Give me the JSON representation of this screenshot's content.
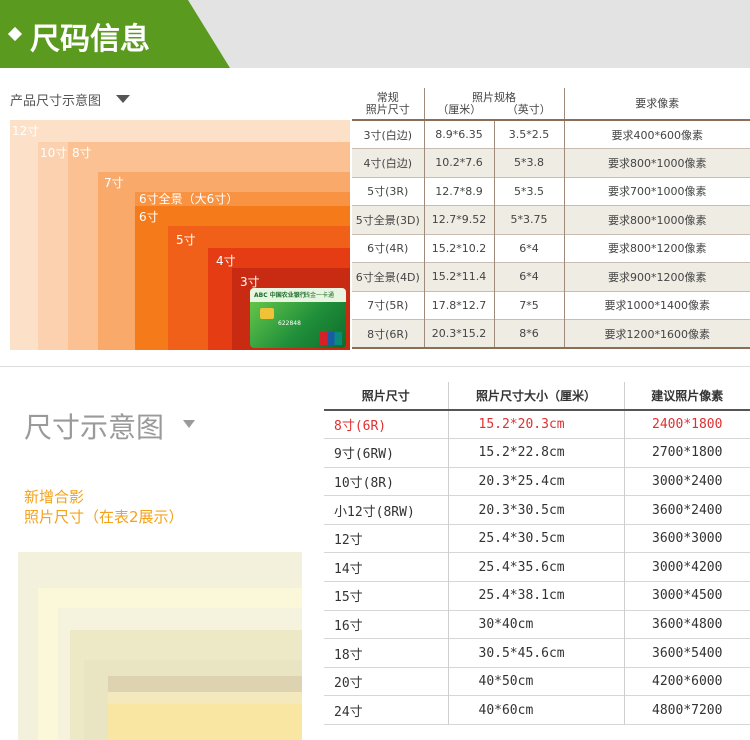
{
  "header": {
    "title": "尺码信息",
    "accent_color": "#5a9a1e"
  },
  "diagram1": {
    "label": "产品尺寸示意图",
    "sizes": [
      {
        "label": "12寸",
        "color": "#fde0c8"
      },
      {
        "label": "10寸",
        "color": "#fcd1b0"
      },
      {
        "label": "8寸",
        "color": "#fbc193"
      },
      {
        "label": "7寸",
        "color": "#f9aa6b"
      },
      {
        "label": "6寸全景（大6寸）",
        "color": "#f79343"
      },
      {
        "label": "6寸",
        "color": "#f47a1a"
      },
      {
        "label": "5寸",
        "color": "#f06018"
      },
      {
        "label": "4寸",
        "color": "#e63c14"
      },
      {
        "label": "3寸",
        "color": "#c82a12"
      }
    ],
    "card": {
      "bank": "ABC 中国农业银行",
      "tag": "钱金一卡通",
      "number": "622848"
    }
  },
  "table1": {
    "headers": {
      "col1_line1": "常规",
      "col1_line2": "照片尺寸",
      "group": "照片规格",
      "col2": "（厘米）",
      "col3": "（英寸）",
      "col4": "要求像素"
    },
    "rows": [
      {
        "name": "3寸(白边)",
        "cm": "8.9*6.35",
        "inch": "3.5*2.5",
        "px": "要求400*600像素"
      },
      {
        "name": "4寸(白边)",
        "cm": "10.2*7.6",
        "inch": "5*3.8",
        "px": "要求800*1000像素"
      },
      {
        "name": "5寸(3R)",
        "cm": "12.7*8.9",
        "inch": "5*3.5",
        "px": "要求700*1000像素"
      },
      {
        "name": "5寸全景(3D)",
        "cm": "12.7*9.52",
        "inch": "5*3.75",
        "px": "要求800*1000像素"
      },
      {
        "name": "6寸(4R)",
        "cm": "15.2*10.2",
        "inch": "6*4",
        "px": "要求800*1200像素"
      },
      {
        "name": "6寸全景(4D)",
        "cm": "15.2*11.4",
        "inch": "6*4",
        "px": "要求900*1200像素"
      },
      {
        "name": "7寸(5R)",
        "cm": "17.8*12.7",
        "inch": "7*5",
        "px": "要求1000*1400像素"
      },
      {
        "name": "8寸(6R)",
        "cm": "20.3*15.2",
        "inch": "8*6",
        "px": "要求1200*1600像素"
      }
    ]
  },
  "section2": {
    "title": "尺寸示意图",
    "note_line1": "新增合影",
    "note_line2": "照片尺寸（在表2展示）",
    "note_color": "#f4a21b"
  },
  "table2": {
    "headers": [
      "照片尺寸",
      "照片尺寸大小（厘米）",
      "建议照片像素"
    ],
    "rows": [
      {
        "size": "8寸(6R)",
        "cm": "15.2*20.3cm",
        "px": "2400*1800",
        "highlight": true
      },
      {
        "size": "9寸(6RW)",
        "cm": "15.2*22.8cm",
        "px": "2700*1800"
      },
      {
        "size": "10寸(8R)",
        "cm": "20.3*25.4cm",
        "px": "3000*2400"
      },
      {
        "size": "小12寸(8RW)",
        "cm": "20.3*30.5cm",
        "px": "3600*2400"
      },
      {
        "size": "12寸",
        "cm": "25.4*30.5cm",
        "px": "3600*3000"
      },
      {
        "size": "14寸",
        "cm": "25.4*35.6cm",
        "px": "3000*4200"
      },
      {
        "size": "15寸",
        "cm": "25.4*38.1cm",
        "px": "3000*4500"
      },
      {
        "size": "16寸",
        "cm": "30*40cm",
        "px": "3600*4800"
      },
      {
        "size": "18寸",
        "cm": "30.5*45.6cm",
        "px": "3600*5400"
      },
      {
        "size": "20寸",
        "cm": "40*50cm",
        "px": "4200*6000"
      },
      {
        "size": "24寸",
        "cm": "40*60cm",
        "px": "4800*7200"
      }
    ]
  }
}
